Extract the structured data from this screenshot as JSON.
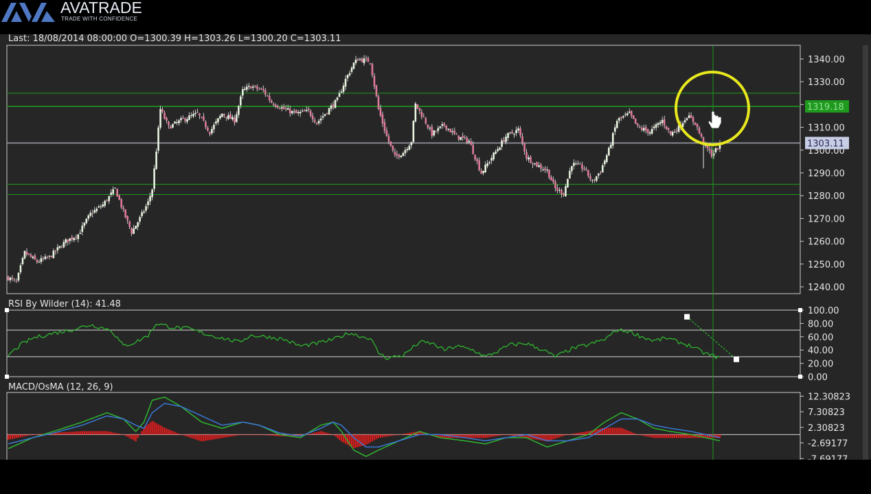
{
  "branding": {
    "name": "AVATRADE",
    "tagline": "TRADE WITH CONFIDENCE",
    "colors": {
      "logo_blue": "#4f78c4",
      "text": "#e8ecf4"
    }
  },
  "colors": {
    "background": "#262626",
    "grid_frame": "#cfcfcf",
    "support_resistance": "#1f9a1f",
    "candle_up": "#e8f4e0",
    "candle_down": "#e07a9a",
    "rsi_line": "#2fb52f",
    "macd_line": "#2fb52f",
    "signal_line": "#3a78d8",
    "osma_bar": "#d41e1e",
    "highlight_circle": "#e8e81e",
    "crosshair": "#1f9a1f"
  },
  "chart_data": [
    {
      "type": "candlestick",
      "header": "Last: 18/08/2014 08:00:00 O=1300.39 H=1303.26 L=1300.20 C=1303.11",
      "ylim": [
        1237,
        1346
      ],
      "y_ticks": [
        "1340.00",
        "1330.00",
        "1320.00",
        "1310.00",
        "1300.00",
        "1290.00",
        "1280.00",
        "1270.00",
        "1260.00",
        "1250.00",
        "1240.00"
      ],
      "close_anchors": [
        [
          0,
          1244
        ],
        [
          4,
          1242
        ],
        [
          8,
          1255
        ],
        [
          14,
          1251
        ],
        [
          20,
          1253
        ],
        [
          28,
          1260
        ],
        [
          34,
          1263
        ],
        [
          40,
          1272
        ],
        [
          46,
          1276
        ],
        [
          52,
          1283
        ],
        [
          56,
          1273
        ],
        [
          60,
          1264
        ],
        [
          64,
          1270
        ],
        [
          68,
          1277
        ],
        [
          70,
          1283
        ],
        [
          72,
          1300
        ],
        [
          74,
          1318
        ],
        [
          78,
          1310
        ],
        [
          84,
          1313
        ],
        [
          92,
          1316
        ],
        [
          98,
          1308
        ],
        [
          104,
          1316
        ],
        [
          110,
          1313
        ],
        [
          114,
          1326
        ],
        [
          118,
          1328
        ],
        [
          124,
          1326
        ],
        [
          128,
          1321
        ],
        [
          134,
          1318
        ],
        [
          140,
          1316
        ],
        [
          146,
          1317
        ],
        [
          150,
          1312
        ],
        [
          156,
          1318
        ],
        [
          160,
          1322
        ],
        [
          164,
          1331
        ],
        [
          168,
          1338
        ],
        [
          170,
          1340
        ],
        [
          176,
          1339
        ],
        [
          180,
          1318
        ],
        [
          184,
          1306
        ],
        [
          188,
          1297
        ],
        [
          192,
          1299
        ],
        [
          196,
          1304
        ],
        [
          198,
          1320
        ],
        [
          202,
          1314
        ],
        [
          206,
          1307
        ],
        [
          212,
          1311
        ],
        [
          218,
          1306
        ],
        [
          224,
          1304
        ],
        [
          230,
          1290
        ],
        [
          236,
          1298
        ],
        [
          242,
          1306
        ],
        [
          248,
          1309
        ],
        [
          252,
          1297
        ],
        [
          256,
          1294
        ],
        [
          262,
          1291
        ],
        [
          266,
          1283
        ],
        [
          270,
          1281
        ],
        [
          274,
          1294
        ],
        [
          280,
          1292
        ],
        [
          284,
          1286
        ],
        [
          288,
          1291
        ],
        [
          292,
          1300
        ],
        [
          296,
          1313
        ],
        [
          302,
          1316
        ],
        [
          306,
          1310
        ],
        [
          312,
          1308
        ],
        [
          318,
          1313
        ],
        [
          322,
          1307
        ],
        [
          326,
          1310
        ],
        [
          330,
          1315
        ],
        [
          334,
          1312
        ],
        [
          338,
          1303
        ],
        [
          342,
          1298
        ],
        [
          346,
          1302
        ]
      ],
      "horizontal_lines": [
        {
          "value": 1325.0
        },
        {
          "value": 1319.18,
          "label": "1319.18"
        },
        {
          "value": 1303.11,
          "label": "1303.11",
          "kind": "last"
        },
        {
          "value": 1285.0
        },
        {
          "value": 1280.5
        }
      ]
    },
    {
      "type": "line",
      "title": "RSI By Wilder (14): 41.48",
      "ylim": [
        0,
        100
      ],
      "y_ticks": [
        "100.00",
        "80.00",
        "60.00",
        "40.00",
        "20.00",
        "0.00"
      ],
      "guide_levels": [
        70,
        30
      ],
      "anchors": [
        [
          0,
          32
        ],
        [
          6,
          48
        ],
        [
          12,
          58
        ],
        [
          20,
          64
        ],
        [
          30,
          70
        ],
        [
          40,
          78
        ],
        [
          50,
          70
        ],
        [
          56,
          46
        ],
        [
          62,
          52
        ],
        [
          68,
          62
        ],
        [
          72,
          80
        ],
        [
          80,
          74
        ],
        [
          88,
          72
        ],
        [
          96,
          64
        ],
        [
          104,
          58
        ],
        [
          112,
          52
        ],
        [
          118,
          62
        ],
        [
          126,
          60
        ],
        [
          134,
          56
        ],
        [
          142,
          46
        ],
        [
          150,
          50
        ],
        [
          158,
          56
        ],
        [
          166,
          66
        ],
        [
          172,
          60
        ],
        [
          176,
          58
        ],
        [
          180,
          36
        ],
        [
          184,
          28
        ],
        [
          192,
          32
        ],
        [
          200,
          52
        ],
        [
          206,
          50
        ],
        [
          212,
          40
        ],
        [
          218,
          46
        ],
        [
          226,
          40
        ],
        [
          232,
          30
        ],
        [
          238,
          38
        ],
        [
          244,
          48
        ],
        [
          252,
          50
        ],
        [
          260,
          40
        ],
        [
          266,
          30
        ],
        [
          274,
          42
        ],
        [
          282,
          48
        ],
        [
          290,
          56
        ],
        [
          296,
          70
        ],
        [
          302,
          68
        ],
        [
          308,
          60
        ],
        [
          314,
          54
        ],
        [
          320,
          58
        ],
        [
          326,
          52
        ],
        [
          332,
          46
        ],
        [
          338,
          36
        ],
        [
          346,
          28
        ]
      ],
      "trendline": [
        [
          330,
          90
        ],
        [
          346,
          26
        ]
      ]
    },
    {
      "type": "line",
      "title": "MACD/OsMA (12, 26, 9)",
      "ylim": [
        -8.5,
        13.5
      ],
      "y_ticks": [
        "12.30823",
        "7.30823",
        "2.30823",
        "-2.69177",
        "-7.69177"
      ],
      "zero": 0.0,
      "series": [
        {
          "name": "",
          "anchors": [
            [
              0,
              -4.5
            ],
            [
              12,
              -1
            ],
            [
              22,
              1
            ],
            [
              36,
              4
            ],
            [
              48,
              7
            ],
            [
              56,
              5
            ],
            [
              62,
              1
            ],
            [
              66,
              4
            ],
            [
              70,
              11
            ],
            [
              76,
              12
            ],
            [
              84,
              9
            ],
            [
              94,
              4
            ],
            [
              104,
              2
            ],
            [
              114,
              4
            ],
            [
              122,
              3
            ],
            [
              132,
              0
            ],
            [
              142,
              -1
            ],
            [
              152,
              3
            ],
            [
              158,
              4
            ],
            [
              162,
              1
            ],
            [
              168,
              -5
            ],
            [
              174,
              -7
            ],
            [
              180,
              -5
            ],
            [
              190,
              -2
            ],
            [
              200,
              1
            ],
            [
              210,
              -1
            ],
            [
              222,
              -2
            ],
            [
              232,
              -3
            ],
            [
              242,
              -1
            ],
            [
              252,
              -1
            ],
            [
              262,
              -4
            ],
            [
              272,
              -2
            ],
            [
              282,
              0
            ],
            [
              290,
              4
            ],
            [
              298,
              7
            ],
            [
              306,
              5
            ],
            [
              314,
              2
            ],
            [
              322,
              1
            ],
            [
              332,
              0
            ],
            [
              346,
              -2
            ]
          ]
        },
        {
          "name": "",
          "anchors": [
            [
              0,
              -3
            ],
            [
              12,
              -1
            ],
            [
              22,
              0.5
            ],
            [
              36,
              3
            ],
            [
              48,
              6
            ],
            [
              56,
              5
            ],
            [
              62,
              3
            ],
            [
              66,
              2
            ],
            [
              70,
              7
            ],
            [
              76,
              10
            ],
            [
              84,
              9
            ],
            [
              94,
              6
            ],
            [
              104,
              3
            ],
            [
              114,
              4
            ],
            [
              122,
              3
            ],
            [
              132,
              0.5
            ],
            [
              142,
              -0.5
            ],
            [
              152,
              2
            ],
            [
              158,
              4
            ],
            [
              162,
              3
            ],
            [
              168,
              -1
            ],
            [
              174,
              -4
            ],
            [
              180,
              -4
            ],
            [
              190,
              -2
            ],
            [
              200,
              0
            ],
            [
              210,
              0
            ],
            [
              222,
              -1
            ],
            [
              232,
              -2
            ],
            [
              242,
              -1
            ],
            [
              252,
              0
            ],
            [
              262,
              -2
            ],
            [
              272,
              -2
            ],
            [
              282,
              -1
            ],
            [
              290,
              2
            ],
            [
              298,
              5
            ],
            [
              306,
              5
            ],
            [
              314,
              3
            ],
            [
              322,
              2
            ],
            [
              332,
              1
            ],
            [
              346,
              -1
            ]
          ]
        }
      ]
    }
  ]
}
